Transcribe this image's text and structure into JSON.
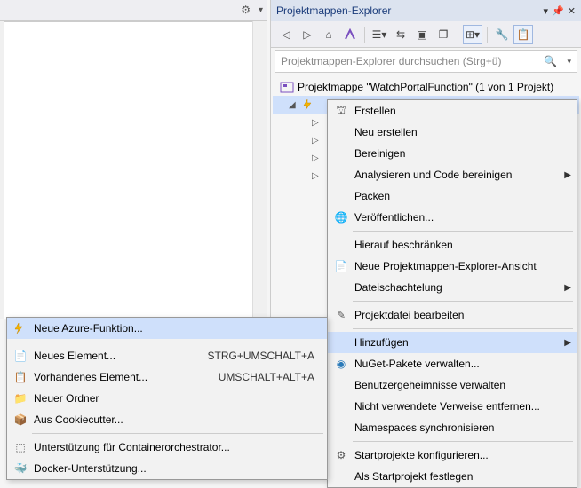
{
  "panel": {
    "title": "Projektmappen-Explorer",
    "search_placeholder": "Projektmappen-Explorer durchsuchen (Strg+ü)",
    "solution_label": "Projektmappe \"WatchPortalFunction\" (1 von 1 Projekt)"
  },
  "context_menu": {
    "items": [
      "Erstellen",
      "Neu erstellen",
      "Bereinigen",
      "Analysieren und Code bereinigen",
      "Packen",
      "Veröffentlichen...",
      "Hierauf beschränken",
      "Neue Projektmappen-Explorer-Ansicht",
      "Dateischachtelung",
      "Projektdatei bearbeiten",
      "Hinzufügen",
      "NuGet-Pakete verwalten...",
      "Benutzergeheimnisse verwalten",
      "Nicht verwendete Verweise entfernen...",
      "Namespaces synchronisieren",
      "Startprojekte konfigurieren...",
      "Als Startprojekt festlegen"
    ]
  },
  "submenu": {
    "items": [
      {
        "label": "Neue Azure-Funktion...",
        "shortcut": ""
      },
      {
        "label": "Neues Element...",
        "shortcut": "STRG+UMSCHALT+A"
      },
      {
        "label": "Vorhandenes Element...",
        "shortcut": "UMSCHALT+ALT+A"
      },
      {
        "label": "Neuer Ordner",
        "shortcut": ""
      },
      {
        "label": "Aus Cookiecutter...",
        "shortcut": ""
      },
      {
        "label": "Unterstützung für Containerorchestrator...",
        "shortcut": ""
      },
      {
        "label": "Docker-Unterstützung...",
        "shortcut": ""
      }
    ]
  }
}
